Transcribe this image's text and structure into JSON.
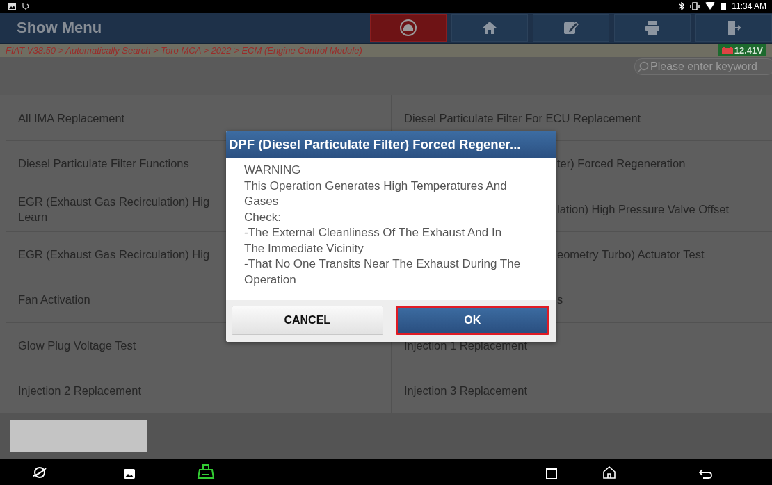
{
  "status_bar": {
    "time": "11:34 AM"
  },
  "header": {
    "title": "Show Menu",
    "buttons": [
      {
        "kind": "diagnose",
        "selected": true
      },
      {
        "kind": "home",
        "selected": false
      },
      {
        "kind": "edit",
        "selected": false
      },
      {
        "kind": "print",
        "selected": false
      },
      {
        "kind": "exit",
        "selected": false
      }
    ]
  },
  "breadcrumb": {
    "path": "FIAT V38.50 > Automatically Search > Toro MCA > 2022 > ECM (Engine Control Module)",
    "voltage": "12.41V"
  },
  "search": {
    "placeholder": "Please enter keyword"
  },
  "menu": {
    "rows": [
      {
        "left": "All IMA Replacement",
        "right": "Diesel Particulate Filter For ECU Replacement",
        "right_covered": false
      },
      {
        "left": "Diesel Particulate Filter Functions",
        "right": "ter) Forced Regeneration",
        "right_covered": true
      },
      {
        "left": "EGR (Exhaust Gas Recirculation) Hig\nLearn",
        "right": "lation) High Pressure Valve Offset",
        "right_covered": true
      },
      {
        "left": "EGR (Exhaust Gas Recirculation) Hig",
        "right": "eometry Turbo) Actuator Test",
        "right_covered": true
      },
      {
        "left": "Fan Activation",
        "right": "s",
        "right_covered": true
      },
      {
        "left": "Glow Plug Voltage Test",
        "right": "Injection 1 Replacement",
        "right_covered": false
      },
      {
        "left": "Injection 2 Replacement",
        "right": "Injection 3 Replacement",
        "right_covered": false
      }
    ]
  },
  "dialog": {
    "title": "DPF (Diesel Particulate Filter) Forced Regener...",
    "message": [
      "WARNING",
      "This Operation Generates High Temperatures And Gases",
      "Check:",
      "-The External Cleanliness Of The Exhaust And In The Immediate Vicinity",
      "-That No One Transits Near The Exhaust During The Operation"
    ],
    "buttons": [
      {
        "label": "CANCEL",
        "kind": "secondary",
        "highlighted": false
      },
      {
        "label": "OK",
        "kind": "primary",
        "highlighted": true
      }
    ]
  },
  "nav_bar": {
    "buttons": [
      {
        "kind": "browser"
      },
      {
        "kind": "gallery"
      },
      {
        "kind": "vci"
      },
      {
        "kind": "recents"
      },
      {
        "kind": "home"
      },
      {
        "kind": "back"
      }
    ]
  }
}
